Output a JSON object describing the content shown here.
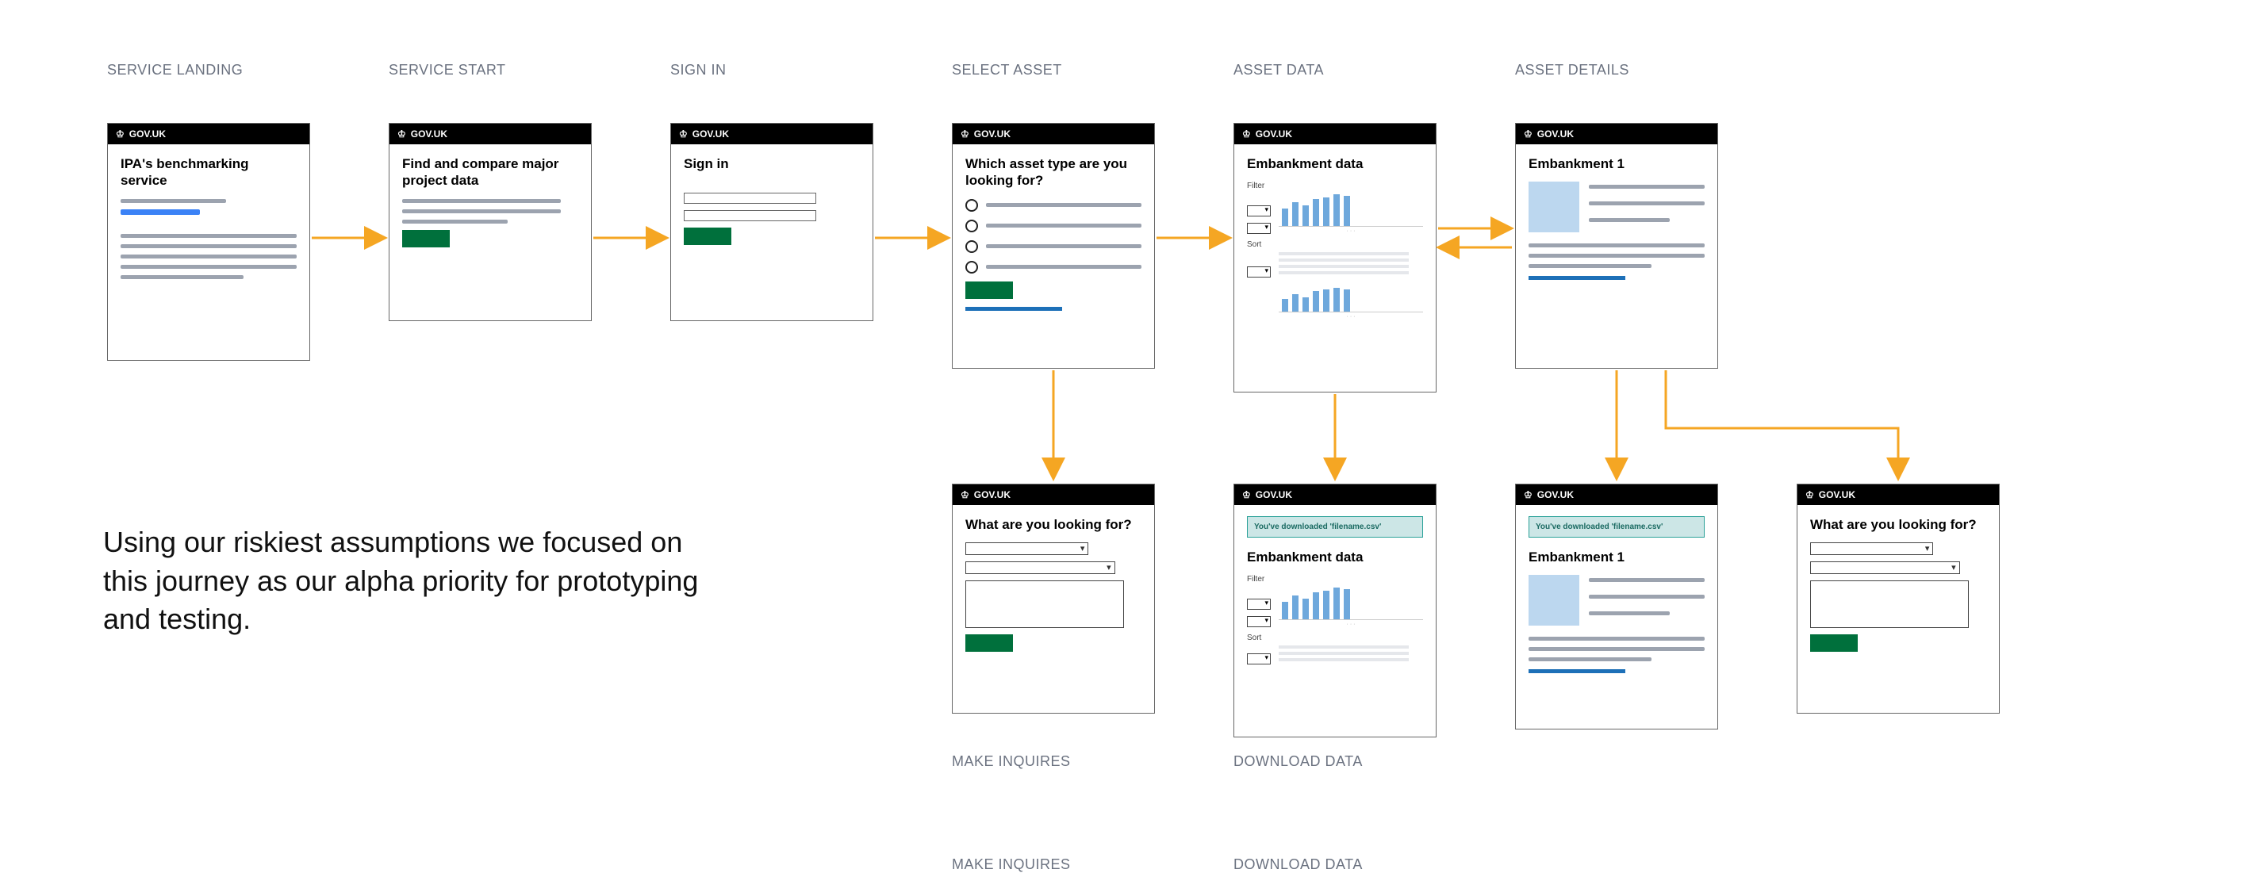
{
  "govuk_label": "GOV.UK",
  "stages": {
    "landing": "SERVICE LANDING",
    "start": "SERVICE START",
    "signin": "SIGN IN",
    "select": "SELECT ASSET",
    "data": "ASSET DATA",
    "details": "ASSET DETAILS",
    "inquires": "MAKE INQUIRES",
    "download": "DOWNLOAD DATA"
  },
  "cards": {
    "landing_title": "IPA's benchmarking service",
    "start_title": "Find and compare major project data",
    "signin_title": "Sign in",
    "select_title": "Which asset type are you looking for?",
    "data_title": "Embankment data",
    "details_title": "Embankment 1",
    "inquires_title": "What are you looking for?",
    "download_notif": "You've downloaded 'filename.csv'",
    "filter_label": "Filter",
    "sort_label": "Sort"
  },
  "sidetext": "Using our riskiest assumptions we focused on this journey as our alpha priority for prototyping and testing."
}
